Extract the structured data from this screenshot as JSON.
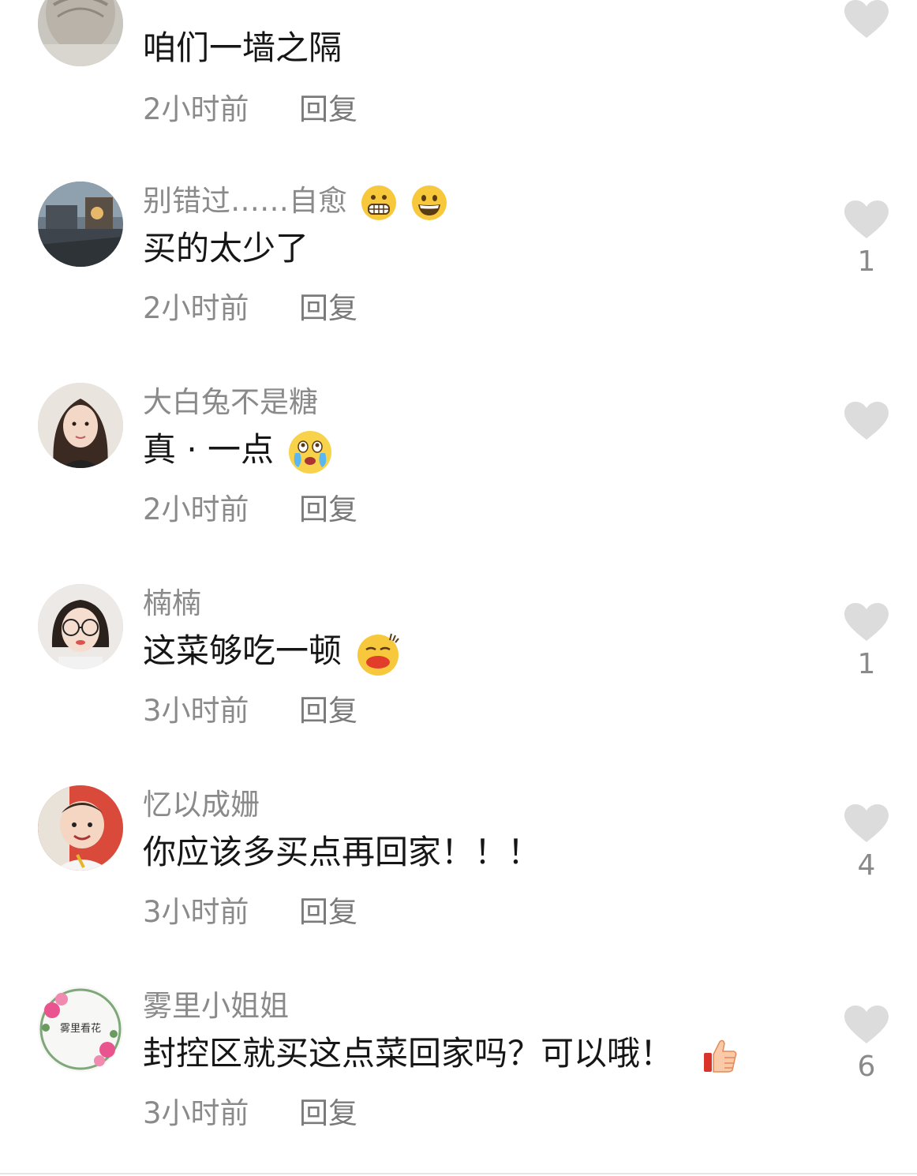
{
  "comments": [
    {
      "username": "",
      "text": "咱们一墙之隔",
      "time": "2小时前",
      "reply": "回复",
      "likes": ""
    },
    {
      "username": "别错过……自愈",
      "username_emojis": [
        "grimacing-face",
        "grinning-face"
      ],
      "text": "买的太少了",
      "time": "2小时前",
      "reply": "回复",
      "likes": "1"
    },
    {
      "username": "大白兔不是糖",
      "text": "真 · 一点",
      "text_emoji": "crying-face",
      "time": "2小时前",
      "reply": "回复",
      "likes": ""
    },
    {
      "username": "楠楠",
      "text": "这菜够吃一顿",
      "text_emoji": "kissing-face",
      "time": "3小时前",
      "reply": "回复",
      "likes": "1"
    },
    {
      "username": "忆以成姗",
      "text": "你应该多买点再回家！！！",
      "time": "3小时前",
      "reply": "回复",
      "likes": "4"
    },
    {
      "username": "雾里小姐姐",
      "avatar_text": "雾里看花",
      "text": "封控区就买这点菜回家吗？可以哦！",
      "text_emoji": "thumbs-up",
      "time": "3小时前",
      "reply": "回复",
      "likes": "6"
    }
  ],
  "colors": {
    "username": "#8a8a8a",
    "text": "#161616",
    "heart": "#dcdcdc"
  }
}
